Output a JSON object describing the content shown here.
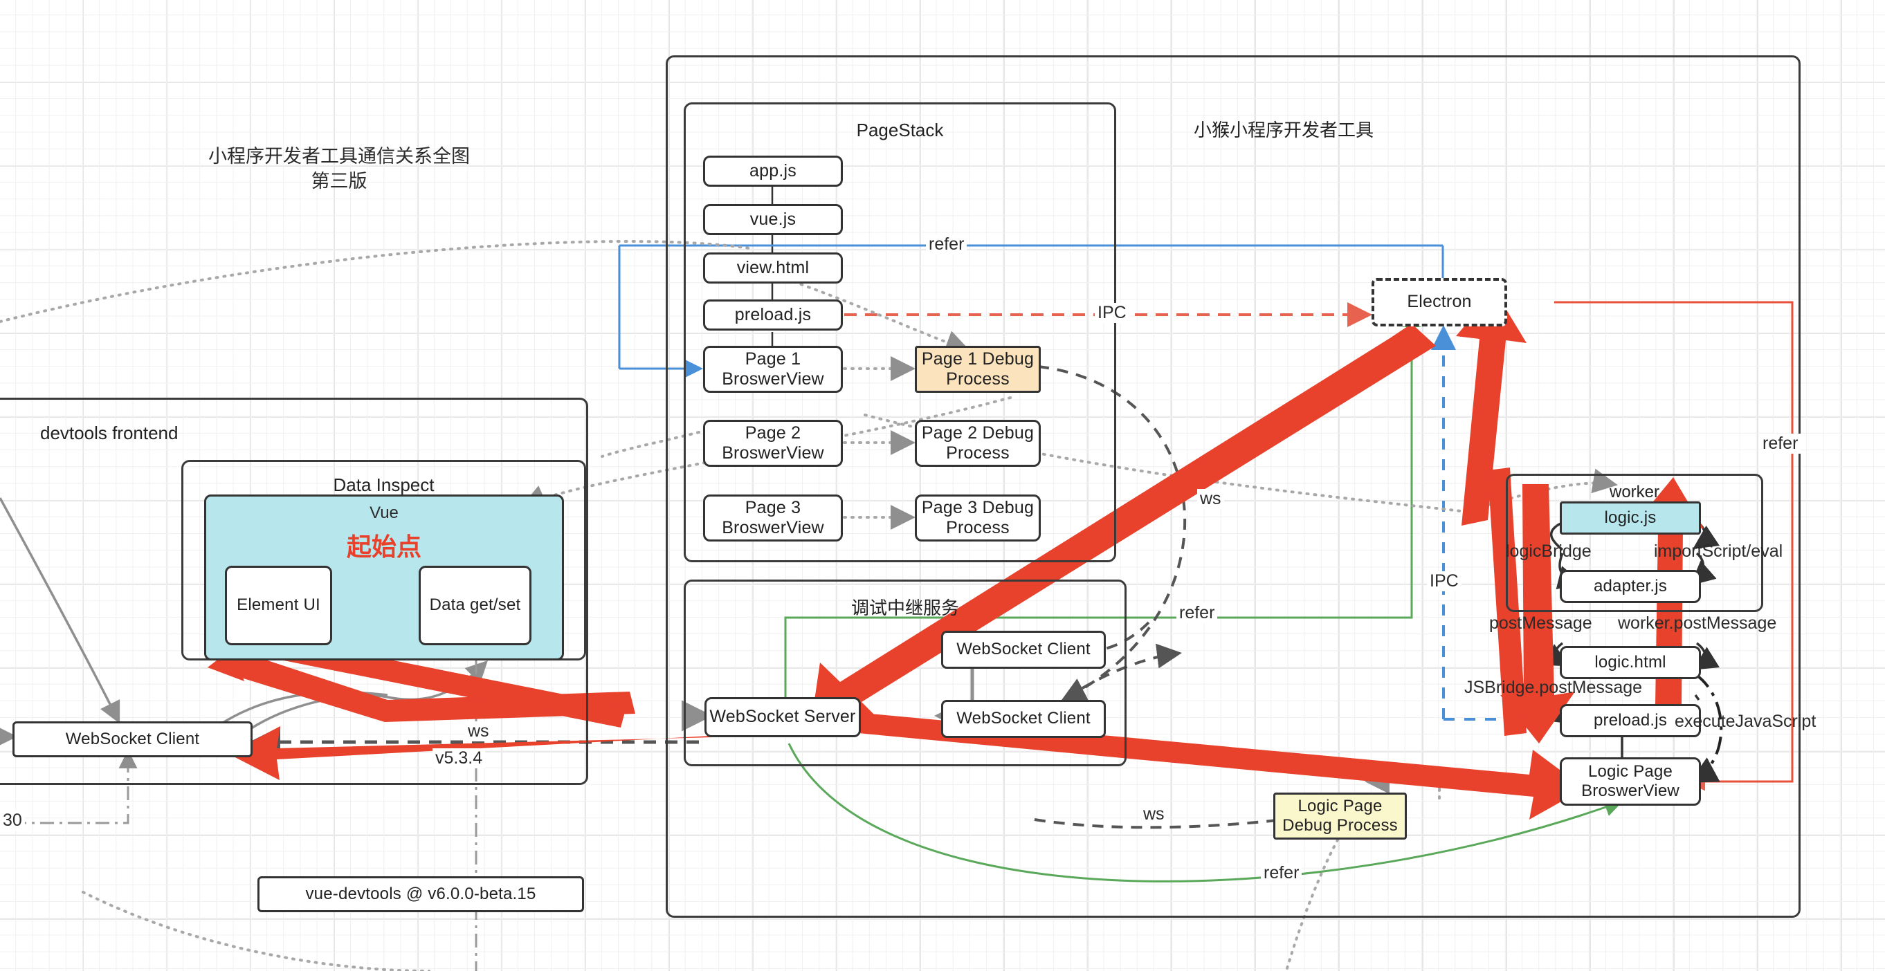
{
  "diagram": {
    "title": "小程序开发者工具通信关系全图\n第三版",
    "containers": {
      "devtools_frontend": "devtools frontend",
      "data_inspect": "Data Inspect",
      "vue": "Vue",
      "pagestack": "PageStack",
      "relay_service": "调试中继服务",
      "devtool_app": "小猴小程序开发者工具",
      "worker": "worker"
    },
    "highlight": {
      "start_point": "起始点",
      "start_point_color": "#e8402a"
    },
    "nodes": {
      "element_ui": "Element UI",
      "data_get_set": "Data get/set",
      "ws_client_devtools": "WebSocket Client",
      "vue_devtools_version": "vue-devtools @ v6.0.0-beta.15",
      "app_js": "app.js",
      "vue_js": "vue.js",
      "view_html": "view.html",
      "preload_js": "preload.js",
      "page1_view": "Page 1\nBroswerView",
      "page2_view": "Page 2\nBroswerView",
      "page3_view": "Page 3\nBroswerView",
      "page1_debug": "Page 1 Debug\nProcess",
      "page2_debug": "Page 2 Debug\nProcess",
      "page3_debug": "Page 3 Debug\nProcess",
      "ws_server": "WebSocket Server",
      "ws_client_relay_1": "WebSocket Client",
      "ws_client_relay_2": "WebSocket Client",
      "electron": "Electron",
      "logic_js": "logic.js",
      "adapter_js": "adapter.js",
      "logic_html": "logic.html",
      "preload_js_logic": "preload.js",
      "logic_page_view": "Logic Page\nBroswerView",
      "logic_page_debug": "Logic Page\nDebug Process"
    },
    "edge_labels": {
      "refer_top": "refer",
      "ipc_pagestack": "IPC",
      "ws_right": "ws",
      "refer_green_mid": "refer",
      "ipc_blue": "IPC",
      "refer_right": "refer",
      "ws_left": "ws",
      "v534": "v5.3.4",
      "port_30": "30",
      "ws_logic": "ws",
      "refer_green_bottom": "refer",
      "logic_bridge": "logicBridge",
      "import_script_eval": "importScript/eval",
      "post_message": "postMessage",
      "worker_post_message": "worker.postMessage",
      "jsbridge_post_message": "JSBridge.postMessage",
      "execute_javascript": "executeJavaScript"
    },
    "colors": {
      "accent_red": "#e8402a",
      "blue": "#4a90d9",
      "green": "#5aa85a",
      "gray": "#8f8f8f",
      "orange_fill": "#fae3bd",
      "yellow_fill": "#fbf7cd",
      "cyan_fill": "#b7e6ec",
      "box_stroke": "#333333"
    }
  }
}
